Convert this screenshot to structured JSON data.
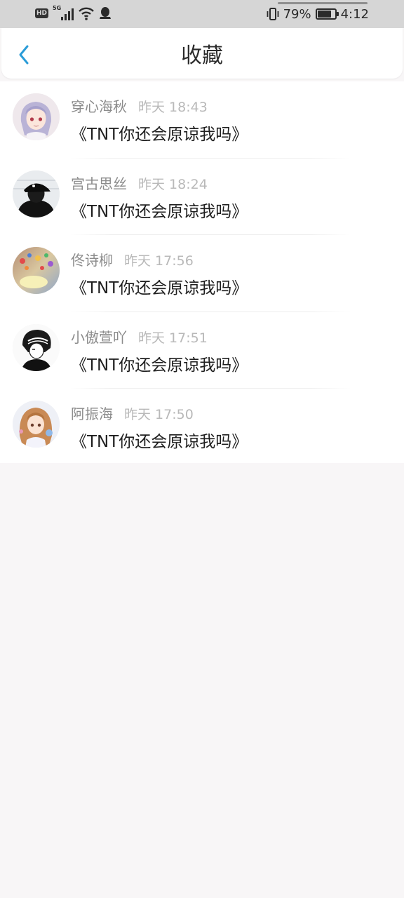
{
  "status_bar": {
    "hd": "HD",
    "network": "5G",
    "battery_percent": "79%",
    "battery_level": 0.79,
    "time": "4:12",
    "icons": [
      "hd-icon",
      "signal-icon",
      "wifi-icon",
      "qq-icon",
      "vibrate-icon",
      "battery-icon"
    ]
  },
  "header": {
    "title": "收藏",
    "back_icon": "chevron-left-icon",
    "accent_color": "#2a9cd8"
  },
  "favorites": [
    {
      "name": "穿心海秋",
      "time": "昨天 18:43",
      "content": "《TNT你还会原谅我吗》"
    },
    {
      "name": "宫古思丝",
      "time": "昨天 18:24",
      "content": "《TNT你还会原谅我吗》"
    },
    {
      "name": "佟诗柳",
      "time": "昨天 17:56",
      "content": "《TNT你还会原谅我吗》"
    },
    {
      "name": "小傲萱吖",
      "time": "昨天 17:51",
      "content": "《TNT你还会原谅我吗》"
    },
    {
      "name": "阿振海",
      "time": "昨天 17:50",
      "content": "《TNT你还会原谅我吗》"
    }
  ]
}
